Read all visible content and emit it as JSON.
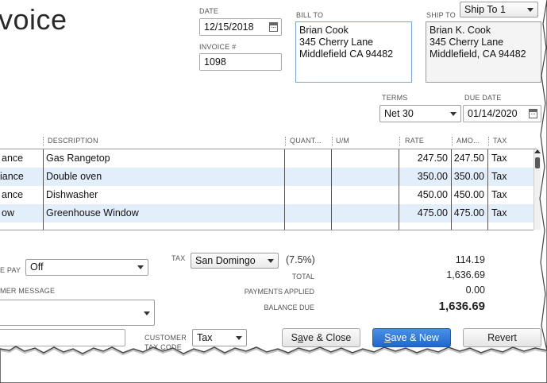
{
  "title": "voice",
  "header": {
    "date_label": "DATE",
    "date_value": "12/15/2018",
    "invoice_label": "INVOICE #",
    "invoice_value": "1098",
    "bill_to_label": "BILL TO",
    "bill_to": [
      "Brian Cook",
      "345 Cherry Lane",
      "Middlefield CA 94482"
    ],
    "ship_to_label": "SHIP TO",
    "ship_to_select": "Ship To 1",
    "ship_to": [
      "Brian K. Cook",
      "345 Cherry Lane",
      "Middlefield, CA 94482"
    ],
    "terms_label": "TERMS",
    "terms_value": "Net 30",
    "due_date_label": "DUE DATE",
    "due_date_value": "01/14/2020"
  },
  "table": {
    "headers": {
      "description": "DESCRIPTION",
      "quantity": "QUANT...",
      "um": "U/M",
      "rate": "RATE",
      "amount": "AMO...",
      "tax": "TAX"
    },
    "rows": [
      {
        "item": "ance",
        "description": "Gas Rangetop",
        "rate": "247.50",
        "amount": "247.50",
        "tax": "Tax"
      },
      {
        "item": "iance",
        "description": "Double oven",
        "rate": "350.00",
        "amount": "350.00",
        "tax": "Tax"
      },
      {
        "item": "ance",
        "description": "Dishwasher",
        "rate": "450.00",
        "amount": "450.00",
        "tax": "Tax"
      },
      {
        "item": "ow",
        "description": "Greenhouse Window",
        "rate": "475.00",
        "amount": "475.00",
        "tax": "Tax"
      }
    ]
  },
  "footer": {
    "online_pay_label": "E PAY",
    "online_pay_value": "Off",
    "customer_message_label": "MER MESSAGE",
    "tax_label": "TAX",
    "tax_select": "San Domingo",
    "tax_rate": "(7.5%)",
    "tax_amount": "114.19",
    "total_label": "TOTAL",
    "total_value": "1,636.69",
    "payments_label": "PAYMENTS APPLIED",
    "payments_value": "0.00",
    "balance_label": "BALANCE DUE",
    "balance_value": "1,636.69",
    "customer_tax_code_label_1": "CUSTOMER",
    "customer_tax_code_label_2": "TAX CODE",
    "customer_tax_code_value": "Tax",
    "save_close_pre": "S",
    "save_close_u": "a",
    "save_close_post": "ve & Close",
    "save_new_u": "S",
    "save_new_post": "ave & New",
    "revert_label": "Revert"
  },
  "colors": {
    "primary_button": "#1f68cc",
    "row_highlight": "#e3eefb",
    "bill_to_border": "#7aa8d6"
  }
}
